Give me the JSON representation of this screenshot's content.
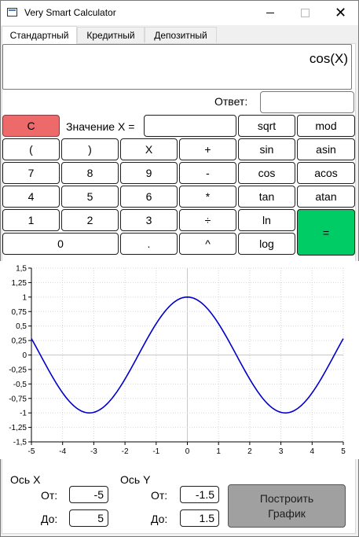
{
  "window": {
    "title": "Very Smart Calculator",
    "minimize": "—",
    "maximize": "☐",
    "close": "✕"
  },
  "tabs": [
    "Стандартный",
    "Кредитный",
    "Депозитный"
  ],
  "active_tab": 0,
  "expression": "cos(X)",
  "answer_label": "Ответ:",
  "answer_value": "",
  "x_value_label": "Значение X =",
  "x_value": "",
  "buttons": {
    "clear": "C",
    "sqrt": "sqrt",
    "mod": "mod",
    "lparen": "(",
    "rparen": ")",
    "x": "X",
    "plus": "+",
    "sin": "sin",
    "asin": "asin",
    "seven": "7",
    "eight": "8",
    "nine": "9",
    "minus": "-",
    "cos": "cos",
    "acos": "acos",
    "four": "4",
    "five": "5",
    "six": "6",
    "multiply": "*",
    "tan": "tan",
    "atan": "atan",
    "one": "1",
    "two": "2",
    "three": "3",
    "divide": "÷",
    "ln": "ln",
    "equals": "=",
    "zero": "0",
    "dot": ".",
    "power": "^",
    "log": "log"
  },
  "colors": {
    "clear": "#ee6a6a",
    "equals": "#00cc66",
    "curve": "#0000cc",
    "plot_button": "#a0a0a0"
  },
  "axes_controls": {
    "x_axis_label": "Ось X",
    "y_axis_label": "Ось Y",
    "from_label": "От:",
    "to_label": "До:",
    "x_from": "-5",
    "x_to": "5",
    "y_from": "-1.5",
    "y_to": "1.5",
    "plot_button": "Построить\nГрафик"
  },
  "chart_data": {
    "type": "line",
    "function": "cos(X)",
    "xlim": [
      -5,
      5
    ],
    "ylim": [
      -1.5,
      1.5
    ],
    "x_ticks": [
      "-5",
      "-4",
      "-3",
      "-2",
      "-1",
      "0",
      "1",
      "2",
      "3",
      "4",
      "5"
    ],
    "y_ticks": [
      "1,5",
      "1,25",
      "1",
      "0,75",
      "0,5",
      "0,25",
      "0",
      "-0,25",
      "-0,5",
      "-0,75",
      "-1",
      "-1,25",
      "-1,5"
    ],
    "grid": true,
    "series": [
      {
        "color": "#0000cc",
        "x": [
          -5,
          -4.5,
          -4,
          -3.5,
          -3,
          -2.5,
          -2,
          -1.5,
          -1,
          -0.5,
          0,
          0.5,
          1,
          1.5,
          2,
          2.5,
          3,
          3.5,
          4,
          4.5,
          5
        ],
        "y": [
          0.284,
          -0.211,
          -0.654,
          -0.936,
          -0.99,
          -0.801,
          -0.416,
          0.071,
          0.54,
          0.878,
          1,
          0.878,
          0.54,
          0.071,
          -0.416,
          -0.801,
          -0.99,
          -0.936,
          -0.654,
          -0.211,
          0.284
        ]
      }
    ]
  }
}
